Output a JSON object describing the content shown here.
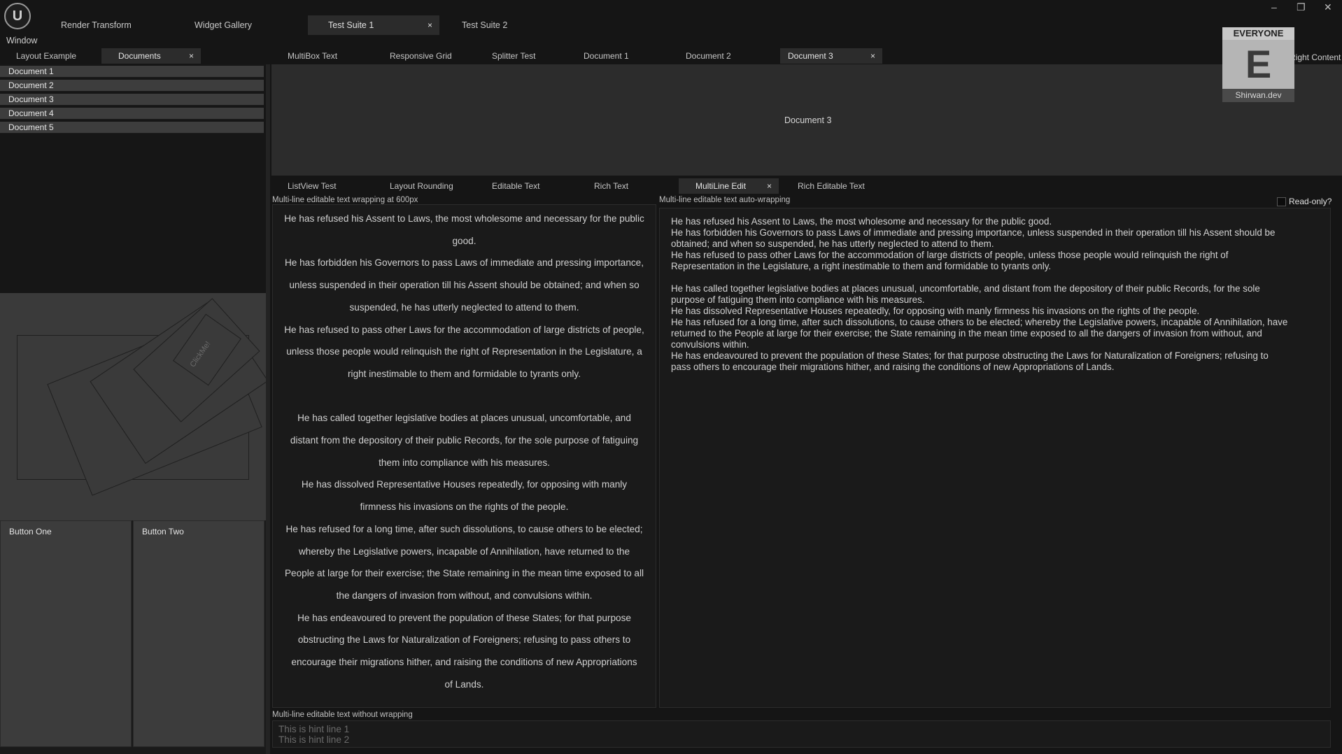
{
  "app": {
    "menu_window": "Window"
  },
  "top_tabs": [
    {
      "label": "Render Transform"
    },
    {
      "label": "Widget Gallery"
    },
    {
      "label": "Test Suite 1",
      "closable": true
    },
    {
      "label": "Test Suite 2"
    }
  ],
  "window_controls": {
    "minimize": "–",
    "restore": "❐",
    "close": "✕"
  },
  "left_tabs": [
    {
      "label": "Layout Example"
    },
    {
      "label": "Documents",
      "closable": true
    }
  ],
  "documents_list": [
    "Document 1",
    "Document 2",
    "Document 3",
    "Document 4",
    "Document 5"
  ],
  "render_card_label": "ClickMe!",
  "buttons": {
    "one": "Button One",
    "two": "Button Two"
  },
  "main_tabs": [
    {
      "label": "MultiBox Text"
    },
    {
      "label": "Responsive Grid"
    },
    {
      "label": "Splitter Test"
    },
    {
      "label": "Document 1"
    },
    {
      "label": "Document 2"
    },
    {
      "label": "Document 3",
      "closable": true
    }
  ],
  "right_content": "Right Content",
  "rating_badge": {
    "top": "EVERYONE",
    "letter": "E",
    "footer": "Shirwan.dev"
  },
  "document_area_text": "Document 3",
  "sub_tabs": [
    {
      "label": "ListView Test"
    },
    {
      "label": "Layout Rounding"
    },
    {
      "label": "Editable Text"
    },
    {
      "label": "Rich Text"
    },
    {
      "label": "MultiLine Edit",
      "closable": true
    },
    {
      "label": "Rich Editable Text"
    }
  ],
  "multiline": {
    "wrap600_label": "Multi-line editable text wrapping at 600px",
    "auto_label": "Multi-line editable text auto-wrapping",
    "readonly_label": "Read-only?",
    "nowrap_label": "Multi-line editable text without wrapping",
    "hint_line1": "This is hint line 1",
    "hint_line2": "This is hint line 2",
    "wrap600_lines": [
      "He has refused his Assent to Laws, the most wholesome and necessary for the public",
      "good.",
      "He has forbidden his Governors to pass Laws of immediate and pressing importance,",
      "unless suspended in their operation till his Assent should be obtained; and when so",
      "suspended, he has utterly neglected to attend to them.",
      "He has refused to pass other Laws for the accommodation of large districts of people,",
      "unless those people would relinquish the right of Representation in the Legislature, a",
      "right inestimable to them and formidable to tyrants only.",
      "",
      "He has called together legislative bodies at places unusual, uncomfortable, and",
      "distant from the depository of their public Records, for the sole purpose of fatiguing",
      "them into compliance with his measures.",
      "He has dissolved Representative Houses repeatedly, for opposing with manly",
      "firmness his invasions on the rights of the people.",
      "He has refused for a long time, after such dissolutions, to cause others to be elected;",
      "whereby the Legislative powers, incapable of Annihilation, have returned to the",
      "People at large for their exercise; the State remaining in the mean time exposed to all",
      "the dangers of invasion from without, and convulsions within.",
      "He has endeavoured to prevent the population of these States; for that purpose",
      "obstructing the Laws for Naturalization of Foreigners; refusing to pass others to",
      "encourage their migrations hither, and raising the conditions of new Appropriations",
      "of Lands."
    ],
    "auto_lines": [
      "He has refused his Assent to Laws, the most wholesome and necessary for the public good.",
      "He has forbidden his Governors to pass Laws of immediate and pressing importance, unless suspended in their operation till his Assent should be",
      "obtained; and when so suspended, he has utterly neglected to attend to them.",
      "He has refused to pass other Laws for the accommodation of large districts of people, unless those people would relinquish the right of",
      "Representation in the Legislature, a right inestimable to them and formidable to tyrants only.",
      "",
      "He has called together legislative bodies at places unusual, uncomfortable, and distant from the depository of their public Records, for the sole",
      "purpose of fatiguing them into compliance with his measures.",
      "He has dissolved Representative Houses repeatedly, for opposing with manly firmness his invasions on the rights of the people.",
      "He has refused for a long time, after such dissolutions, to cause others to be elected; whereby the Legislative powers, incapable of Annihilation, have",
      "returned to the People at large for their exercise; the State remaining in the mean time exposed to all the dangers of invasion from without, and",
      "convulsions within.",
      "He has endeavoured to prevent the population of these States; for that purpose obstructing the Laws for Naturalization of Foreigners; refusing to",
      "pass others to encourage their migrations hither, and raising the conditions of new Appropriations of Lands."
    ]
  }
}
